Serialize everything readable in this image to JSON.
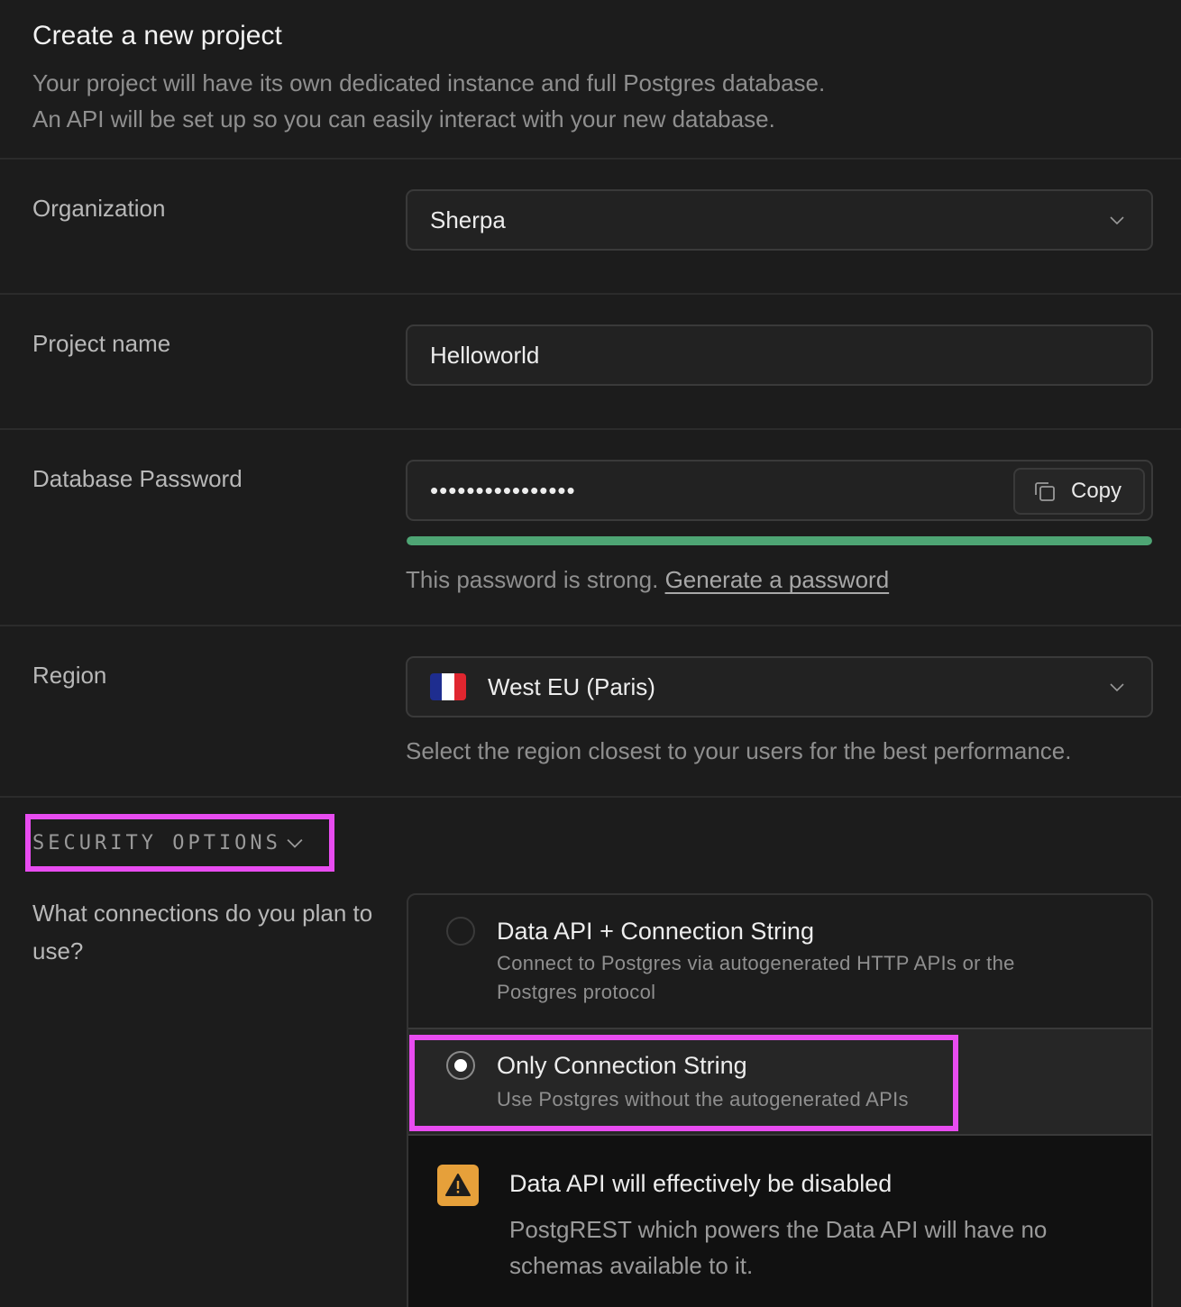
{
  "header": {
    "title": "Create a new project",
    "subtitle_line1": "Your project will have its own dedicated instance and full Postgres database.",
    "subtitle_line2": "An API will be set up so you can easily interact with your new database."
  },
  "organization": {
    "label": "Organization",
    "value": "Sherpa"
  },
  "project_name": {
    "label": "Project name",
    "value": "Helloworld"
  },
  "database_password": {
    "label": "Database Password",
    "value": "••••••••••••••••",
    "copy_label": "Copy",
    "strength_fraction": 1.0,
    "strength_color": "#4ea574",
    "helper_text": "This password is strong.",
    "generate_link": "Generate a password"
  },
  "region": {
    "label": "Region",
    "value": "West EU (Paris)",
    "flag": "france-flag",
    "helper_text": "Select the region closest to your users for the best performance."
  },
  "security": {
    "toggle_label": "SECURITY OPTIONS",
    "question": "What connections do you plan to use?",
    "options": [
      {
        "title": "Data API + Connection String",
        "description": "Connect to Postgres via autogenerated HTTP APIs or the Postgres protocol",
        "selected": false
      },
      {
        "title": "Only Connection String",
        "description": "Use Postgres without the autogenerated APIs",
        "selected": true
      }
    ],
    "warning": {
      "title": "Data API will effectively be disabled",
      "body": "PostgREST which powers the Data API will have no schemas available to it.",
      "icon": "warning-triangle-icon",
      "icon_color": "#e6a03a"
    }
  },
  "colors": {
    "highlight": "#e84cf0",
    "background": "#1c1c1c"
  }
}
